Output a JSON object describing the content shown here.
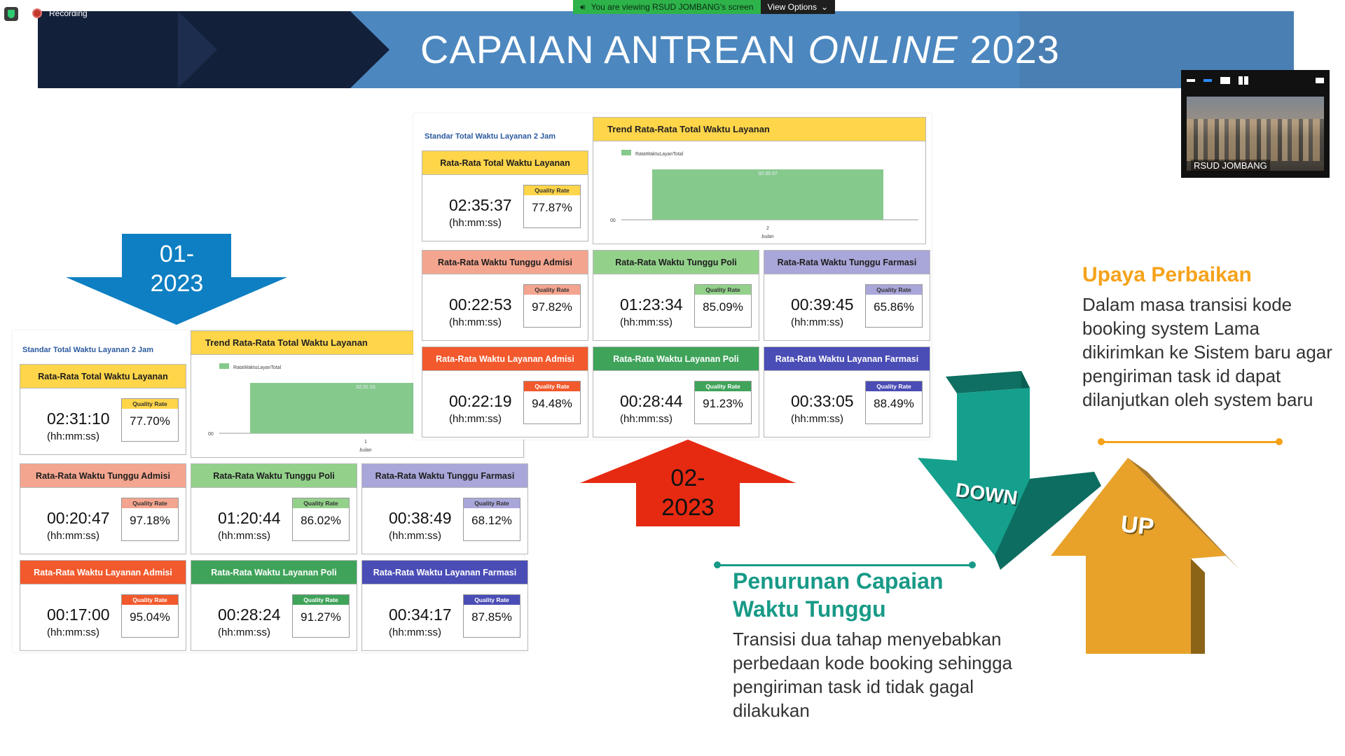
{
  "zoom": {
    "recording_label": "Recording",
    "share_notice": "You are viewing RSUD JOMBANG's screen",
    "view_options_label": "View Options",
    "video_participant_name": "RSUD JOMBANG"
  },
  "slide": {
    "title_regular": "CAPAIAN ANTREAN ",
    "title_italic": "ONLINE",
    "title_year": " 2023"
  },
  "arrows": {
    "period_1": [
      "01-",
      "2023"
    ],
    "period_2": [
      "02-",
      "2023"
    ],
    "down_label": "DOWN",
    "up_label": "UP"
  },
  "colors": {
    "yellow": "#ffd54a",
    "salmon": "#f4a58f",
    "green_light": "#93d18b",
    "purple_light": "#a9a6d9",
    "orange_red": "#f2592c",
    "green_dark": "#3fa35a",
    "indigo": "#4a4db5",
    "trend_bar": "#86c98c"
  },
  "dash_jan": {
    "standard": "Standar Total Waktu Layanan 2 Jam",
    "trend_title": "Trend Rata-Rata Total Waktu Layanan",
    "trend_legend": "RataWaktuLayanTotal",
    "trend_bar_label": "02:31:10",
    "trend_y_tick": "00",
    "trend_x_tick": "1",
    "trend_x_label": "bulan",
    "unit": "(hh:mm:ss)",
    "quality_label": "Quality Rate",
    "cards": [
      {
        "title": "Rata-Rata Total Waktu Layanan",
        "time": "02:31:10",
        "quality": "77.70%"
      },
      {
        "title": "Rata-Rata Waktu Tunggu Admisi",
        "time": "00:20:47",
        "quality": "97.18%"
      },
      {
        "title": "Rata-Rata Waktu Tunggu Poli",
        "time": "01:20:44",
        "quality": "86.02%"
      },
      {
        "title": "Rata-Rata Waktu Tunggu Farmasi",
        "time": "00:38:49",
        "quality": "68.12%"
      },
      {
        "title": "Rata-Rata Waktu Layanan Admisi",
        "time": "00:17:00",
        "quality": "95.04%"
      },
      {
        "title": "Rata-Rata Waktu Layanan Poli",
        "time": "00:28:24",
        "quality": "91.27%"
      },
      {
        "title": "Rata-Rata Waktu Layanan Farmasi",
        "time": "00:34:17",
        "quality": "87.85%"
      }
    ]
  },
  "dash_feb": {
    "standard": "Standar Total Waktu Layanan 2 Jam",
    "trend_title": "Trend Rata-Rata Total Waktu Layanan",
    "trend_legend": "RataWaktuLayanTotal",
    "trend_bar_label": "02:35:37",
    "trend_y_tick": "00",
    "trend_x_tick": "2",
    "trend_x_label": "bulan",
    "unit": "(hh:mm:ss)",
    "quality_label": "Quality Rate",
    "cards": [
      {
        "title": "Rata-Rata Total Waktu Layanan",
        "time": "02:35:37",
        "quality": "77.87%"
      },
      {
        "title": "Rata-Rata Waktu Tunggu Admisi",
        "time": "00:22:53",
        "quality": "97.82%"
      },
      {
        "title": "Rata-Rata Waktu Tunggu Poli",
        "time": "01:23:34",
        "quality": "85.09%"
      },
      {
        "title": "Rata-Rata Waktu Tunggu Farmasi",
        "time": "00:39:45",
        "quality": "65.86%"
      },
      {
        "title": "Rata-Rata Waktu Layanan Admisi",
        "time": "00:22:19",
        "quality": "94.48%"
      },
      {
        "title": "Rata-Rata Waktu Layanan Poli",
        "time": "00:28:44",
        "quality": "91.23%"
      },
      {
        "title": "Rata-Rata Waktu Layanan Farmasi",
        "time": "00:33:05",
        "quality": "88.49%"
      }
    ]
  },
  "improvement": {
    "title": "Upaya Perbaikan",
    "text": "Dalam masa transisi kode booking system Lama dikirimkan ke Sistem baru agar pengiriman task id dapat dilanjutkan oleh system baru"
  },
  "decline": {
    "title": "Penurunan Capaian Waktu Tunggu",
    "text": "Transisi dua tahap menyebabkan perbedaan kode booking sehingga pengiriman task id tidak gagal dilakukan"
  }
}
